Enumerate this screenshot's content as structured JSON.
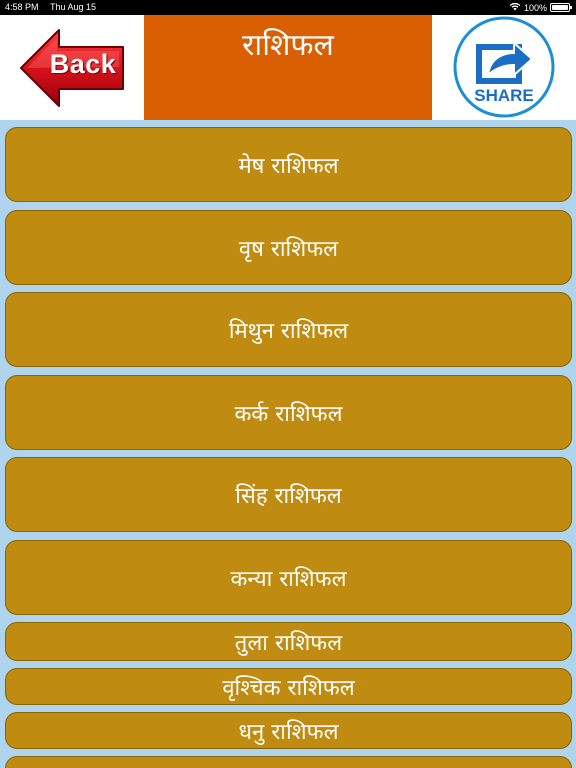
{
  "status_bar": {
    "time": "4:58 PM",
    "date": "Thu Aug 15",
    "battery": "100%"
  },
  "header": {
    "back_label": "Back",
    "title": "राशिफल",
    "share_label": "SHARE"
  },
  "list": {
    "items": [
      "मेष राशिफल",
      "वृष राशिफल",
      "मिथुन राशिफल",
      "कर्क राशिफल",
      "सिंह राशिफल",
      "कन्या राशिफल",
      "तुला राशिफल",
      "वृश्चिक राशिफल",
      "धनु राशिफल"
    ]
  },
  "colors": {
    "title_bg": "#d95f02",
    "item_bg": "#bf8b10",
    "list_bg": "#aed4ee",
    "back_arrow": "#d8121b",
    "share_blue": "#1a6fc4"
  },
  "icons": {
    "back": "back-arrow-icon",
    "share": "share-arrow-icon",
    "wifi": "wifi-icon",
    "battery": "battery-icon"
  }
}
